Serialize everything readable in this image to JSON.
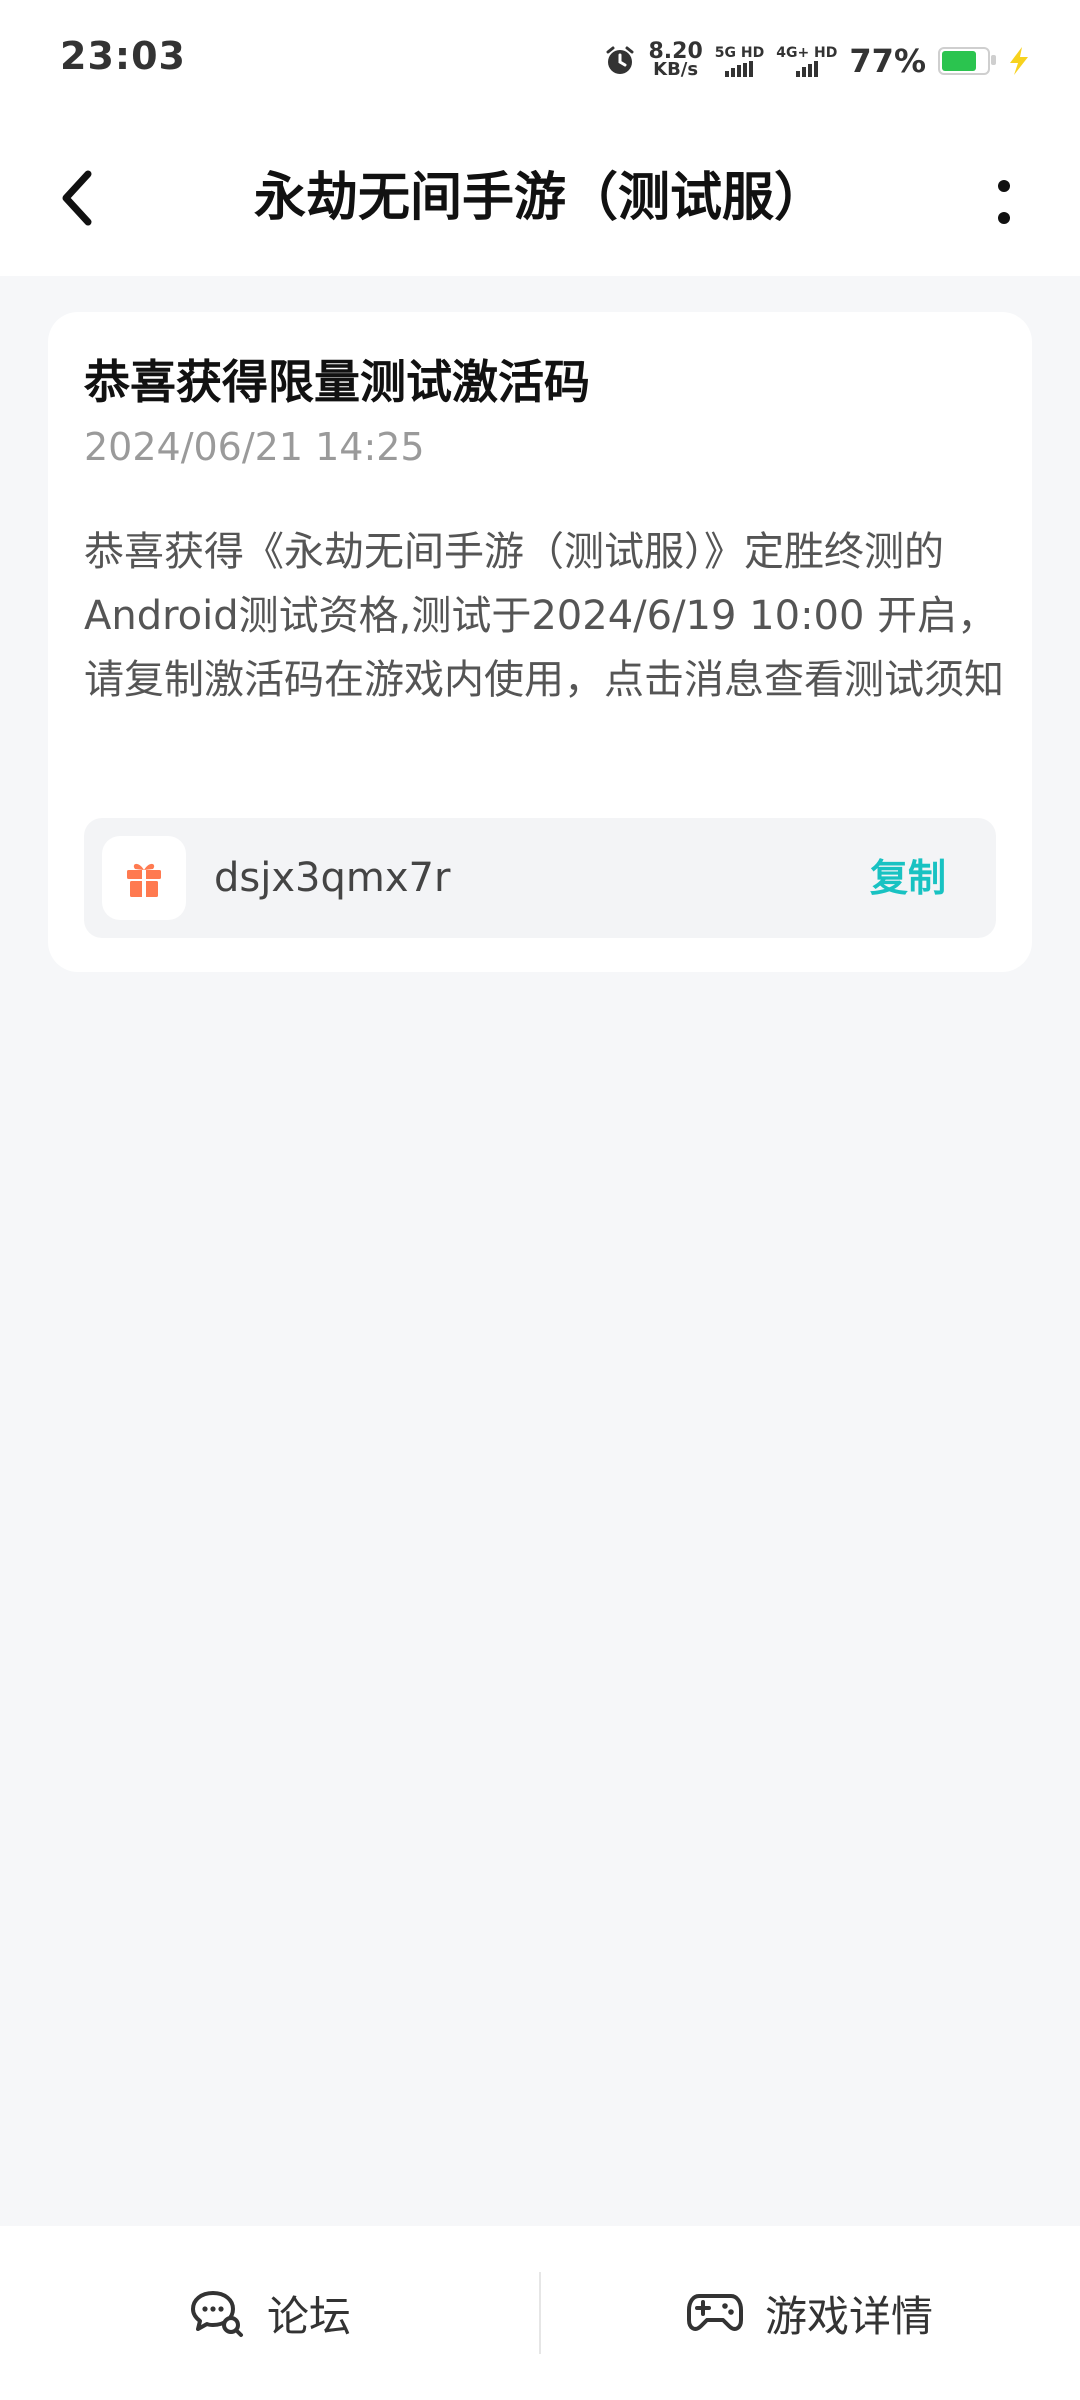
{
  "status": {
    "time": "23:03",
    "speed_value": "8.20",
    "speed_unit": "KB/s",
    "sim1_label": "5G HD",
    "sim2_label": "4G+ HD",
    "battery_percent": "77%",
    "battery_level": 0.77,
    "battery_color": "#2bc44f"
  },
  "header": {
    "title": "永劫无间手游（测试服）"
  },
  "card": {
    "title": "恭喜获得限量测试激活码",
    "date": "2024/06/21 14:25",
    "body": "恭喜获得《永劫无间手游（测试服）》定胜终测的Android测试资格,测试于2024/6/19 10:00 开启，请复制激活码在游戏内使用，点击消息查看测试须知",
    "code": "dsjx3qmx7r",
    "copy_label": "复制",
    "accent_color": "#18c2c2",
    "gift_color": "#ff7a50"
  },
  "bottom_nav": {
    "forum_label": "论坛",
    "game_detail_label": "游戏详情"
  }
}
